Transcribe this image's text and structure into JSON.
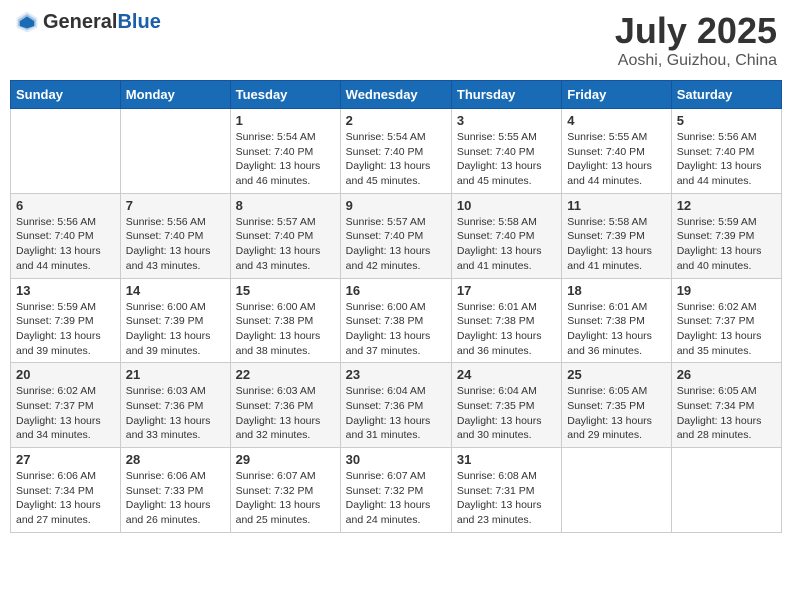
{
  "header": {
    "logo_general": "General",
    "logo_blue": "Blue",
    "month": "July 2025",
    "location": "Aoshi, Guizhou, China"
  },
  "days_of_week": [
    "Sunday",
    "Monday",
    "Tuesday",
    "Wednesday",
    "Thursday",
    "Friday",
    "Saturday"
  ],
  "weeks": [
    [
      {
        "day": "",
        "info": ""
      },
      {
        "day": "",
        "info": ""
      },
      {
        "day": "1",
        "info": "Sunrise: 5:54 AM\nSunset: 7:40 PM\nDaylight: 13 hours and 46 minutes."
      },
      {
        "day": "2",
        "info": "Sunrise: 5:54 AM\nSunset: 7:40 PM\nDaylight: 13 hours and 45 minutes."
      },
      {
        "day": "3",
        "info": "Sunrise: 5:55 AM\nSunset: 7:40 PM\nDaylight: 13 hours and 45 minutes."
      },
      {
        "day": "4",
        "info": "Sunrise: 5:55 AM\nSunset: 7:40 PM\nDaylight: 13 hours and 44 minutes."
      },
      {
        "day": "5",
        "info": "Sunrise: 5:56 AM\nSunset: 7:40 PM\nDaylight: 13 hours and 44 minutes."
      }
    ],
    [
      {
        "day": "6",
        "info": "Sunrise: 5:56 AM\nSunset: 7:40 PM\nDaylight: 13 hours and 44 minutes."
      },
      {
        "day": "7",
        "info": "Sunrise: 5:56 AM\nSunset: 7:40 PM\nDaylight: 13 hours and 43 minutes."
      },
      {
        "day": "8",
        "info": "Sunrise: 5:57 AM\nSunset: 7:40 PM\nDaylight: 13 hours and 43 minutes."
      },
      {
        "day": "9",
        "info": "Sunrise: 5:57 AM\nSunset: 7:40 PM\nDaylight: 13 hours and 42 minutes."
      },
      {
        "day": "10",
        "info": "Sunrise: 5:58 AM\nSunset: 7:40 PM\nDaylight: 13 hours and 41 minutes."
      },
      {
        "day": "11",
        "info": "Sunrise: 5:58 AM\nSunset: 7:39 PM\nDaylight: 13 hours and 41 minutes."
      },
      {
        "day": "12",
        "info": "Sunrise: 5:59 AM\nSunset: 7:39 PM\nDaylight: 13 hours and 40 minutes."
      }
    ],
    [
      {
        "day": "13",
        "info": "Sunrise: 5:59 AM\nSunset: 7:39 PM\nDaylight: 13 hours and 39 minutes."
      },
      {
        "day": "14",
        "info": "Sunrise: 6:00 AM\nSunset: 7:39 PM\nDaylight: 13 hours and 39 minutes."
      },
      {
        "day": "15",
        "info": "Sunrise: 6:00 AM\nSunset: 7:38 PM\nDaylight: 13 hours and 38 minutes."
      },
      {
        "day": "16",
        "info": "Sunrise: 6:00 AM\nSunset: 7:38 PM\nDaylight: 13 hours and 37 minutes."
      },
      {
        "day": "17",
        "info": "Sunrise: 6:01 AM\nSunset: 7:38 PM\nDaylight: 13 hours and 36 minutes."
      },
      {
        "day": "18",
        "info": "Sunrise: 6:01 AM\nSunset: 7:38 PM\nDaylight: 13 hours and 36 minutes."
      },
      {
        "day": "19",
        "info": "Sunrise: 6:02 AM\nSunset: 7:37 PM\nDaylight: 13 hours and 35 minutes."
      }
    ],
    [
      {
        "day": "20",
        "info": "Sunrise: 6:02 AM\nSunset: 7:37 PM\nDaylight: 13 hours and 34 minutes."
      },
      {
        "day": "21",
        "info": "Sunrise: 6:03 AM\nSunset: 7:36 PM\nDaylight: 13 hours and 33 minutes."
      },
      {
        "day": "22",
        "info": "Sunrise: 6:03 AM\nSunset: 7:36 PM\nDaylight: 13 hours and 32 minutes."
      },
      {
        "day": "23",
        "info": "Sunrise: 6:04 AM\nSunset: 7:36 PM\nDaylight: 13 hours and 31 minutes."
      },
      {
        "day": "24",
        "info": "Sunrise: 6:04 AM\nSunset: 7:35 PM\nDaylight: 13 hours and 30 minutes."
      },
      {
        "day": "25",
        "info": "Sunrise: 6:05 AM\nSunset: 7:35 PM\nDaylight: 13 hours and 29 minutes."
      },
      {
        "day": "26",
        "info": "Sunrise: 6:05 AM\nSunset: 7:34 PM\nDaylight: 13 hours and 28 minutes."
      }
    ],
    [
      {
        "day": "27",
        "info": "Sunrise: 6:06 AM\nSunset: 7:34 PM\nDaylight: 13 hours and 27 minutes."
      },
      {
        "day": "28",
        "info": "Sunrise: 6:06 AM\nSunset: 7:33 PM\nDaylight: 13 hours and 26 minutes."
      },
      {
        "day": "29",
        "info": "Sunrise: 6:07 AM\nSunset: 7:32 PM\nDaylight: 13 hours and 25 minutes."
      },
      {
        "day": "30",
        "info": "Sunrise: 6:07 AM\nSunset: 7:32 PM\nDaylight: 13 hours and 24 minutes."
      },
      {
        "day": "31",
        "info": "Sunrise: 6:08 AM\nSunset: 7:31 PM\nDaylight: 13 hours and 23 minutes."
      },
      {
        "day": "",
        "info": ""
      },
      {
        "day": "",
        "info": ""
      }
    ]
  ]
}
